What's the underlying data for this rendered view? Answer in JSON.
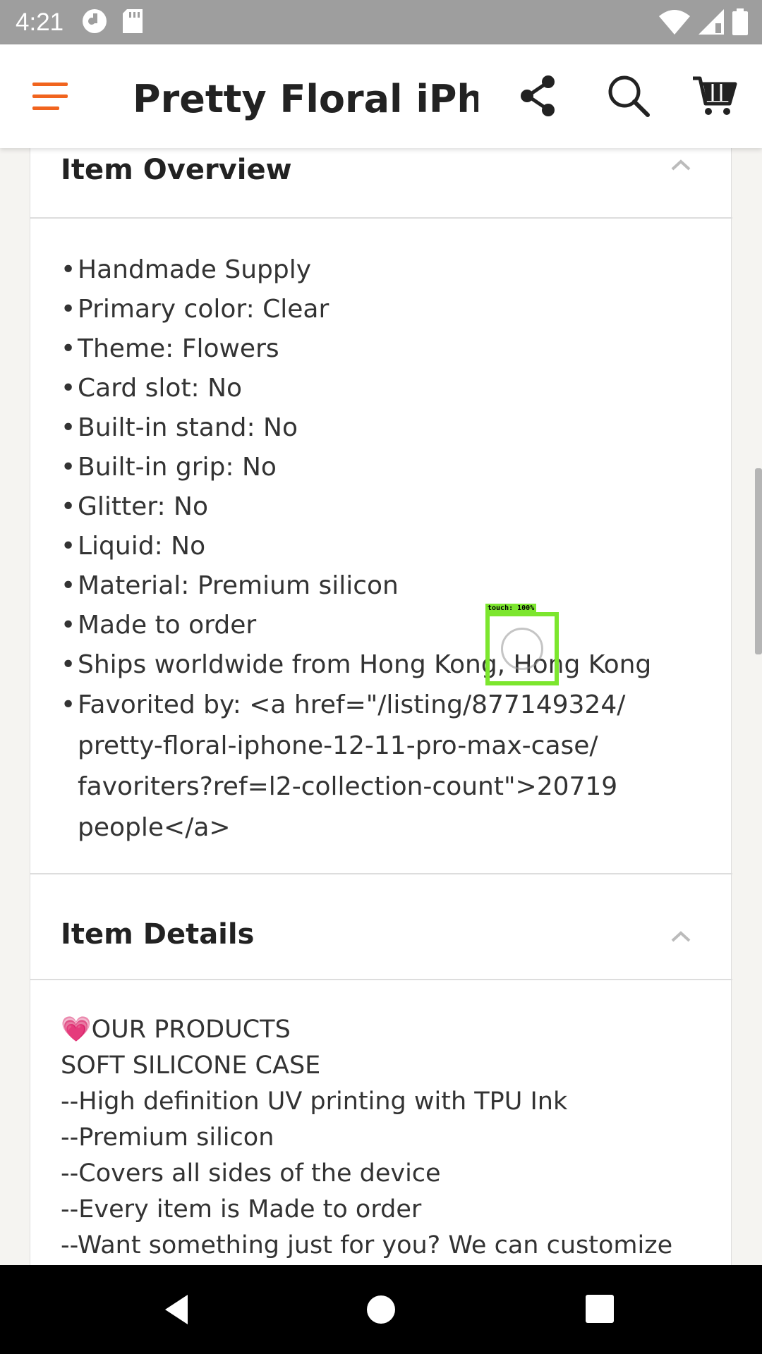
{
  "status_bar": {
    "time": "4:21",
    "icons_left": [
      "sync-icon",
      "sd-card-icon"
    ],
    "icons_right": [
      "wifi-icon",
      "signal-icon",
      "battery-icon"
    ]
  },
  "app_bar": {
    "title": "Pretty Floral iPho…",
    "icons": [
      "menu-icon",
      "share-icon",
      "search-icon",
      "cart-icon"
    ],
    "accent_color": "#f1641e"
  },
  "item_overview": {
    "title": "Item Overview",
    "items": [
      "Handmade Supply",
      "Primary color: Clear",
      "Theme: Flowers",
      "Card slot: No",
      "Built-in stand: No",
      "Built-in grip: No",
      "Glitter: No",
      "Liquid: No",
      "Material: Premium silicon",
      "Made to order",
      "Ships worldwide from Hong Kong, Hong Kong"
    ],
    "favorited_lines": [
      "Favorited by: <a href=\"/listing/877149324/",
      "pretty-floral-iphone-12-11-pro-max-case/",
      "favoriters?ref=l2-collection-count\">20719",
      "people</a>"
    ]
  },
  "item_details": {
    "title": "Item Details",
    "heart": "💗",
    "lines": [
      "OUR PRODUCTS",
      "SOFT SILICONE CASE",
      "--High definition UV printing with TPU Ink",
      "--Premium silicon",
      "--Covers all sides of the device",
      "--Every item is Made to order",
      "--Want something just for you? We can customize"
    ]
  },
  "touch_indicator": {
    "label": "touch: 100%"
  }
}
